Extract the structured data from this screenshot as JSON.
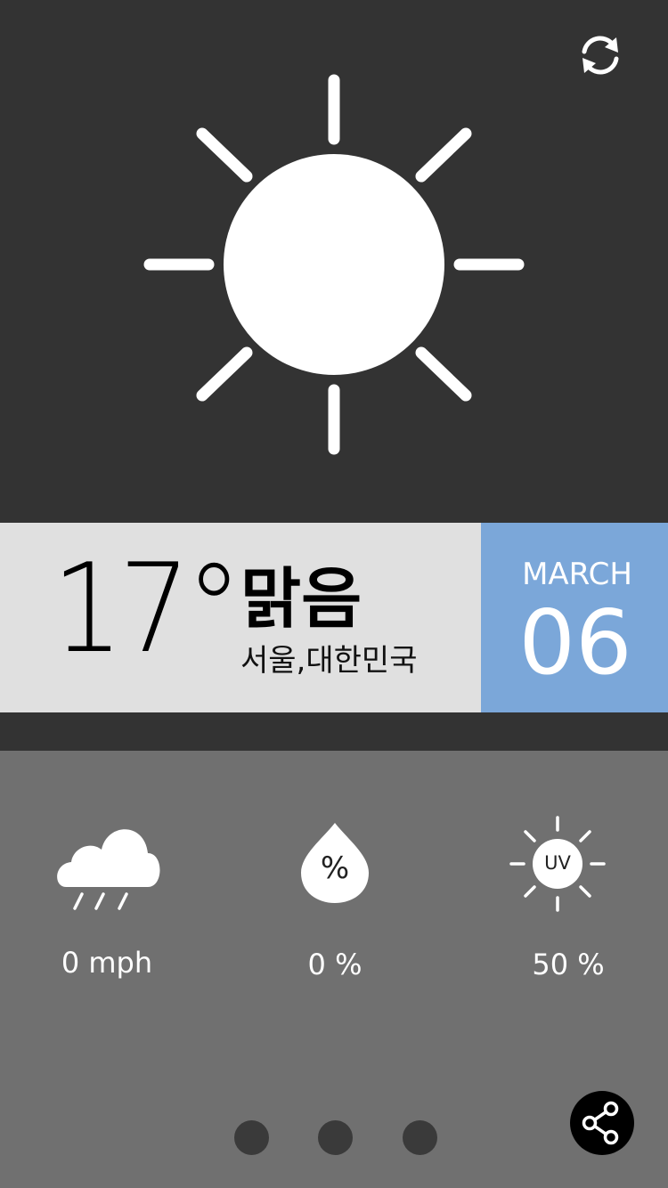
{
  "weather": {
    "temperature": "17°",
    "condition": "맑음",
    "location": "서울,대한민국",
    "icon": "sun-icon"
  },
  "date": {
    "month": "MARCH",
    "day": "06"
  },
  "stats": [
    {
      "icon": "rain-cloud-icon",
      "value": "0 mph"
    },
    {
      "icon": "humidity-drop-icon",
      "icon_text": "%",
      "value": "0 %"
    },
    {
      "icon": "uv-sun-icon",
      "icon_text": "UV",
      "value": "50 %"
    }
  ],
  "pager": {
    "pages": 3
  },
  "colors": {
    "top_bg": "#333333",
    "info_band_bg": "#e0e0e0",
    "date_bg": "#7ba7d9",
    "bottom_bg": "#707070",
    "dot": "#3a3a3a",
    "share_bg": "#000000"
  },
  "actions": {
    "refresh_icon": "refresh-icon",
    "share_icon": "share-icon"
  }
}
